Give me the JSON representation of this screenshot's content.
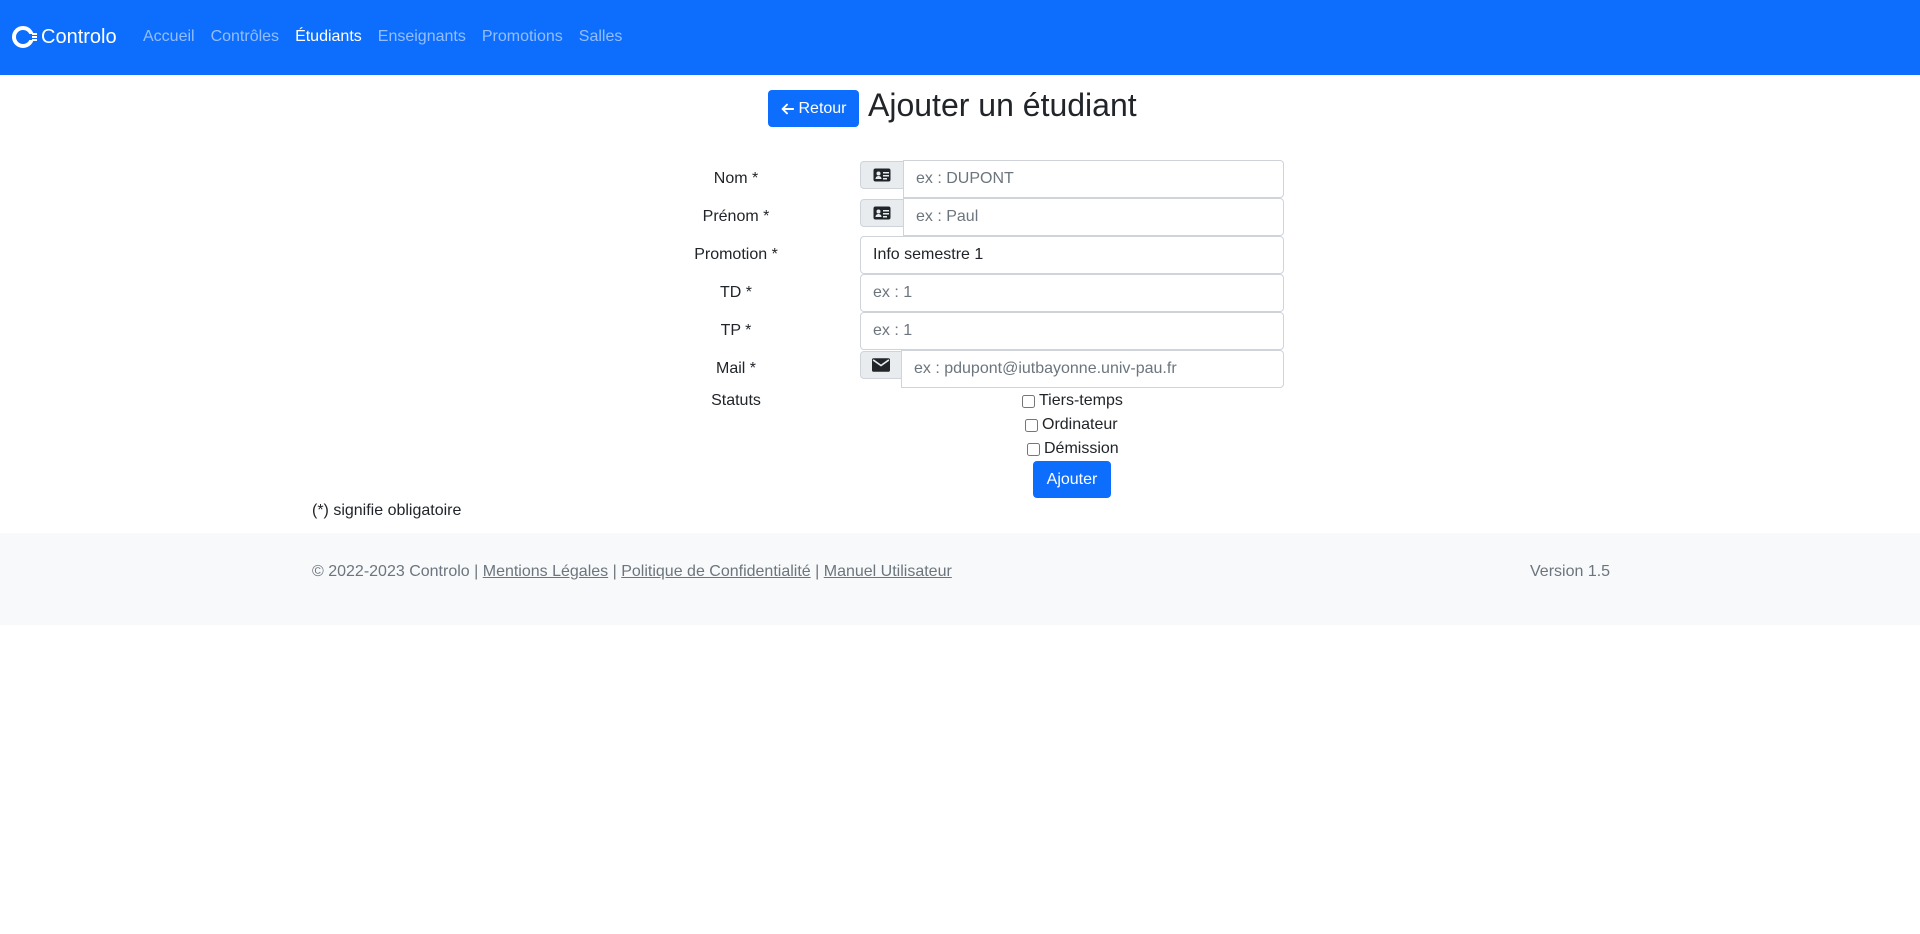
{
  "brand": {
    "name": "Controlo",
    "icon": "controlo-logo-icon"
  },
  "nav": {
    "items": [
      {
        "label": "Accueil",
        "active": false
      },
      {
        "label": "Contrôles",
        "active": false
      },
      {
        "label": "Étudiants",
        "active": true
      },
      {
        "label": "Enseignants",
        "active": false
      },
      {
        "label": "Promotions",
        "active": false
      },
      {
        "label": "Salles",
        "active": false
      }
    ]
  },
  "header": {
    "back_label": "Retour",
    "back_icon": "arrow-left-icon",
    "title": "Ajouter un étudiant"
  },
  "form": {
    "nom": {
      "label": "Nom *",
      "placeholder": "ex : DUPONT",
      "value": "",
      "icon": "id-card-icon"
    },
    "prenom": {
      "label": "Prénom *",
      "placeholder": "ex : Paul",
      "value": "",
      "icon": "id-card-icon"
    },
    "promotion": {
      "label": "Promotion *",
      "value": "Info semestre 1"
    },
    "td": {
      "label": "TD *",
      "placeholder": "ex : 1",
      "value": ""
    },
    "tp": {
      "label": "TP *",
      "placeholder": "ex : 1",
      "value": ""
    },
    "mail": {
      "label": "Mail *",
      "placeholder": "ex : pdupont@iutbayonne.univ-pau.fr",
      "value": "",
      "icon": "envelope-icon"
    },
    "statuts": {
      "label": "Statuts",
      "options": [
        {
          "label": "Tiers-temps",
          "checked": false
        },
        {
          "label": "Ordinateur",
          "checked": false
        },
        {
          "label": "Démission",
          "checked": false
        }
      ]
    },
    "submit_label": "Ajouter",
    "required_note": "(*) signifie obligatoire"
  },
  "footer": {
    "copyright": "© 2022-2023 Controlo |",
    "links": [
      "Mentions Légales",
      "Politique de Confidentialité",
      "Manuel Utilisateur"
    ],
    "separator": "|",
    "version": "Version 1.5"
  },
  "colors": {
    "primary": "#0d6efd",
    "footer_bg": "#f8f9fa",
    "muted": "#6c757d"
  }
}
